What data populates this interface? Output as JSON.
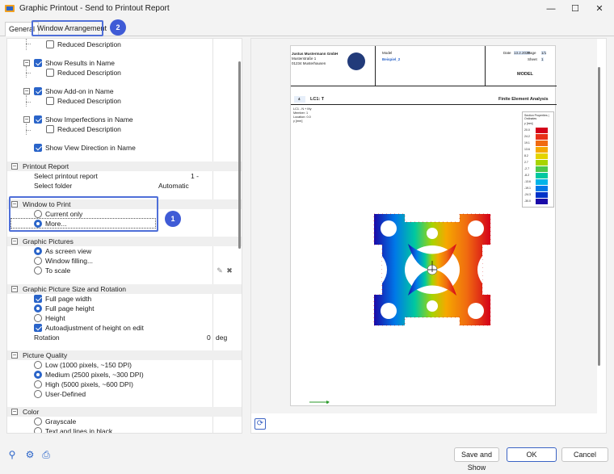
{
  "window": {
    "title": "Graphic Printout - Send to Printout Report",
    "minimize": "—",
    "maximize": "☐",
    "close": "✕"
  },
  "tabs": [
    {
      "label": "General"
    },
    {
      "label": "Window Arrangement"
    }
  ],
  "badges": [
    "1",
    "2"
  ],
  "left_panel": {
    "rows": {
      "reduced_description_1": "Reduced Description",
      "show_results_in_name": "Show Results in Name",
      "reduced_description_2": "Reduced Description",
      "show_addon_in_name": "Show Add-on in Name",
      "reduced_description_3": "Reduced Description",
      "show_imperfections_in_name": "Show Imperfections in Name",
      "reduced_description_4": "Reduced Description",
      "show_view_direction_in_name": "Show View Direction in Name"
    },
    "printout_report": {
      "header": "Printout Report",
      "select_report_label": "Select printout report",
      "select_report_value": "1 -",
      "select_folder_label": "Select folder",
      "select_folder_value": "Automatic"
    },
    "window_to_print": {
      "header": "Window to Print",
      "current_only": "Current only",
      "more": "More..."
    },
    "graphic_pictures": {
      "header": "Graphic Pictures",
      "as_screen_view": "As screen view",
      "window_filling": "Window filling...",
      "to_scale": "To scale"
    },
    "size_rotation": {
      "header": "Graphic Picture Size and Rotation",
      "full_page_width": "Full page width",
      "full_page_height": "Full page height",
      "height": "Height",
      "autoadjustment": "Autoadjustment of height on edit",
      "rotation_label": "Rotation",
      "rotation_value": "0",
      "rotation_unit": "deg"
    },
    "picture_quality": {
      "header": "Picture Quality",
      "low": "Low (1000 pixels, ~150 DPI)",
      "medium": "Medium (2500 pixels, ~300 DPI)",
      "high": "High (5000 pixels, ~600 DPI)",
      "user_defined": "User-Defined"
    },
    "color": {
      "header": "Color",
      "grayscale": "Grayscale",
      "text_lines_black": "Text and lines in black"
    }
  },
  "preview": {
    "company_name": "Justus Mustermann GmbH",
    "company_street": "Musterstraße 1",
    "company_city": "01234 Musterhausen",
    "model_label": "Model",
    "model_value": "Beispiel_2",
    "date_label": "Date",
    "date_value": "13.2.2025",
    "page_label": "Page",
    "page_value": "1/1",
    "sheet_label": "Sheet",
    "sheet_value": "1",
    "section_title": "MODEL",
    "chapter_num": "4",
    "chapter_title": "LC1: T",
    "chapter_right": "Finite Element Analysis",
    "info_lines": [
      "LC1 - N + My",
      "Member: 1",
      "Location: 0.0",
      "y [mm]"
    ],
    "legend_title": "Section Properties | Ordinates",
    "legend_unit": "y [mm]",
    "legend_values": [
      "20.0",
      "24.2",
      "19.1",
      "13.6",
      "8.2",
      "2.7",
      "-2.7",
      "-8.2",
      "-13.6",
      "-19.1",
      "-24.3",
      "-30.0"
    ],
    "legend_colors": [
      "#d4001a",
      "#e8301a",
      "#f06a10",
      "#f5a800",
      "#e4d400",
      "#a8d400",
      "#4cc84c",
      "#00c8a0",
      "#00b4e8",
      "#0078e8",
      "#0032c8",
      "#1a0aa8"
    ],
    "axis_label": "y"
  },
  "footer": {
    "save_and_show": "Save and Show",
    "ok": "OK",
    "cancel": "Cancel"
  }
}
